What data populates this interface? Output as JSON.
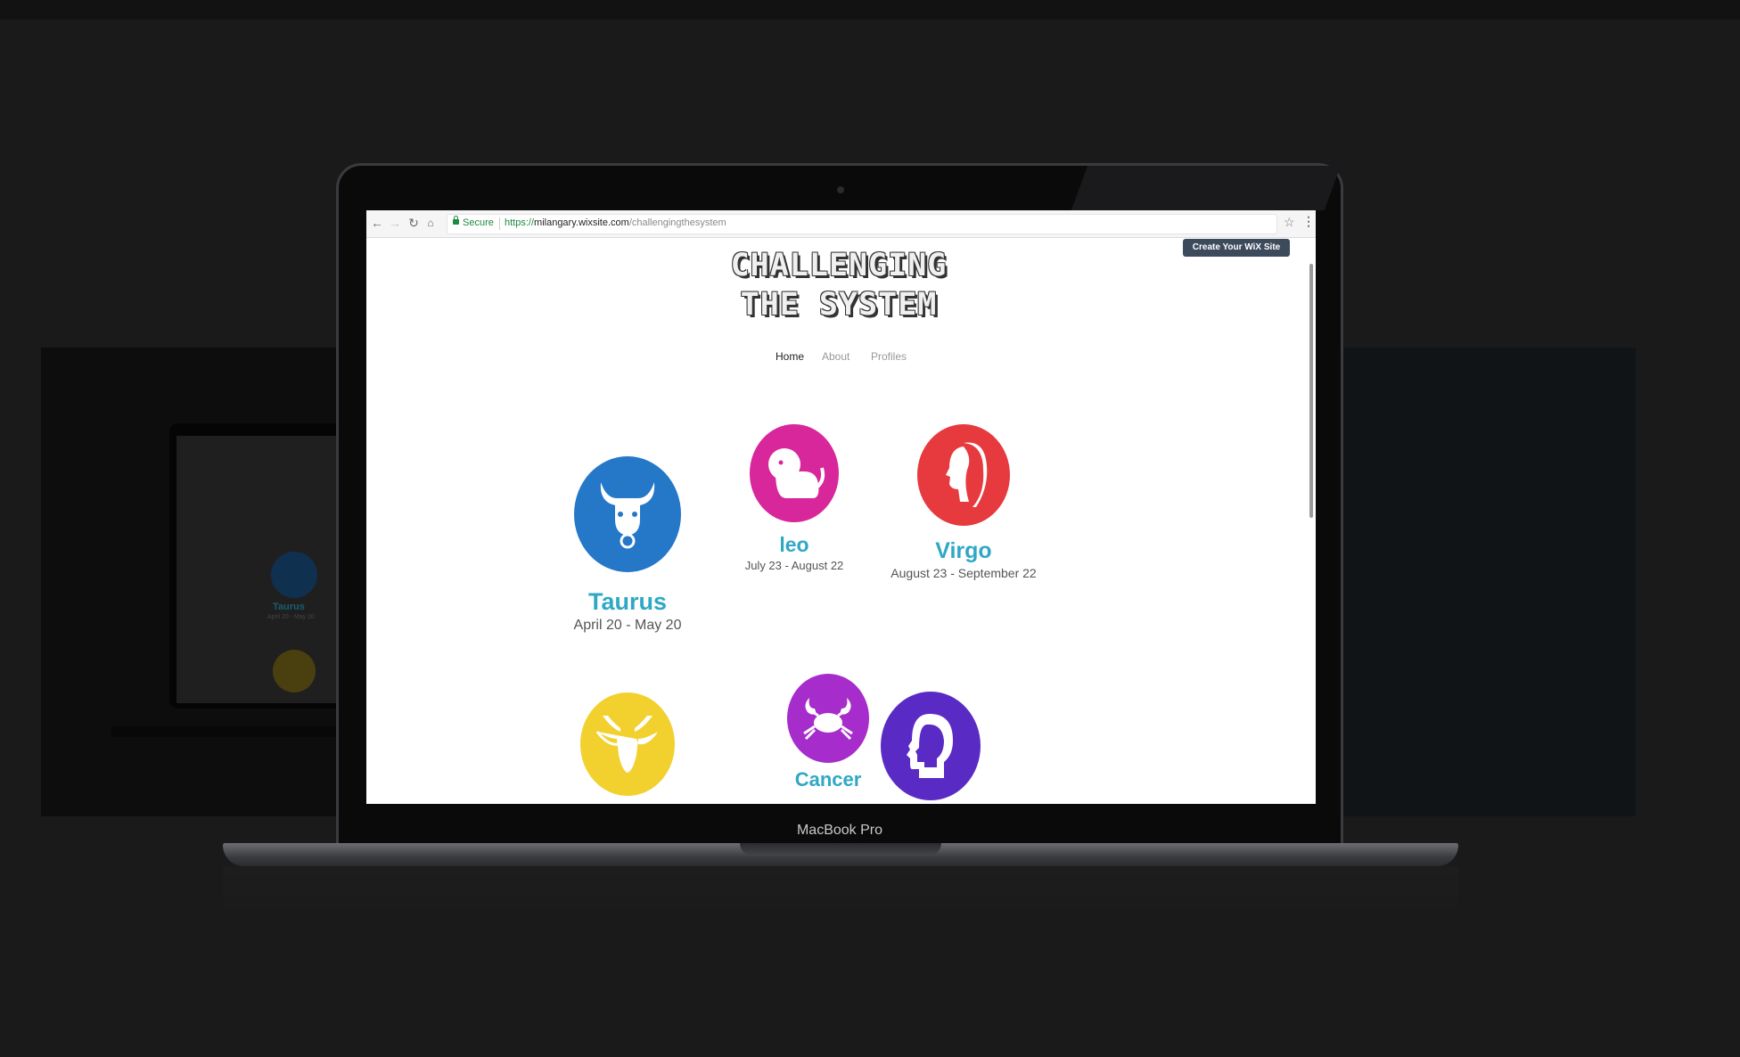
{
  "device": {
    "model_label": "MacBook Pro"
  },
  "browser": {
    "secure_label": "Secure",
    "url_scheme": "https://",
    "url_host": "milangary.wixsite.com",
    "url_path": "/challengingthesystem",
    "icons": [
      "back-arrow-icon",
      "forward-arrow-icon",
      "reload-icon",
      "home-icon",
      "lock-icon",
      "star-icon",
      "kebab-menu-icon"
    ]
  },
  "wix_banner": {
    "label": "Create Your WiX Site"
  },
  "site": {
    "title_line1": "CHALLENGING",
    "title_line2": "THE SYSTEM",
    "nav": [
      {
        "label": "Home",
        "active": true
      },
      {
        "label": "About",
        "active": false
      },
      {
        "label": "Profiles",
        "active": false
      }
    ]
  },
  "signs": [
    {
      "name": "Taurus",
      "dates": "April 20 - May 20",
      "color": "#2577c8",
      "icon": "bull-icon"
    },
    {
      "name": "leo",
      "dates": "July 23 - August 22",
      "color": "#d8279a",
      "icon": "lion-icon"
    },
    {
      "name": "Virgo",
      "dates": "August 23 - September 22",
      "color": "#e63a3e",
      "icon": "maiden-icon"
    },
    {
      "name": "",
      "dates": "",
      "color": "#f2d02e",
      "icon": "goat-icon"
    },
    {
      "name": "Cancer",
      "dates": "",
      "color": "#a62ccb",
      "icon": "crab-icon"
    },
    {
      "name": "",
      "dates": "",
      "color": "#5a2bc4",
      "icon": "head-profile-icon"
    }
  ],
  "background_preview": {
    "sign_name": "Taurus",
    "sign_dates": "April 20 - May 20"
  }
}
